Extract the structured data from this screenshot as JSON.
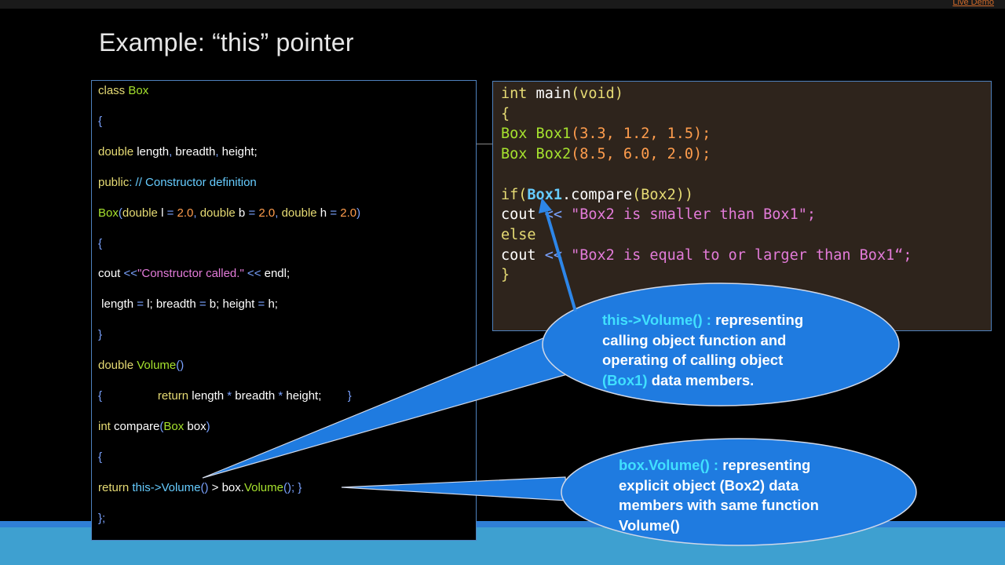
{
  "header": {
    "live_demo": "Live Demo",
    "title": "Example: “this” pointer"
  },
  "left_code": [
    [
      {
        "t": "class",
        "c": "k"
      },
      {
        "t": " Box",
        "c": "t"
      }
    ],
    [
      {
        "t": "{",
        "c": "o"
      }
    ],
    [
      {
        "t": "double",
        "c": "k"
      },
      {
        "t": " length",
        "c": "b"
      },
      {
        "t": ",",
        "c": "o"
      },
      {
        "t": " breadth",
        "c": "b"
      },
      {
        "t": ",",
        "c": "o"
      },
      {
        "t": " height;",
        "c": "b"
      }
    ],
    [
      {
        "t": "public",
        "c": "k"
      },
      {
        "t": ": // Constructor definition",
        "c": "c"
      }
    ],
    [
      {
        "t": "Box",
        "c": "t"
      },
      {
        "t": "(",
        "c": "o"
      },
      {
        "t": "double",
        "c": "k"
      },
      {
        "t": " l ",
        "c": "b"
      },
      {
        "t": "=",
        "c": "o"
      },
      {
        "t": " 2.0",
        "c": "n"
      },
      {
        "t": ",",
        "c": "o"
      },
      {
        "t": " double",
        "c": "k"
      },
      {
        "t": " b ",
        "c": "b"
      },
      {
        "t": "=",
        "c": "o"
      },
      {
        "t": " 2.0",
        "c": "n"
      },
      {
        "t": ",",
        "c": "o"
      },
      {
        "t": " double",
        "c": "k"
      },
      {
        "t": " h ",
        "c": "b"
      },
      {
        "t": "=",
        "c": "o"
      },
      {
        "t": " 2.0",
        "c": "n"
      },
      {
        "t": ")",
        "c": "o"
      }
    ],
    [
      {
        "t": "{",
        "c": "o"
      }
    ],
    [
      {
        "t": "cout ",
        "c": "b"
      },
      {
        "t": "<<",
        "c": "o"
      },
      {
        "t": "\"Constructor called.\"",
        "c": "s"
      },
      {
        "t": " << ",
        "c": "o"
      },
      {
        "t": "endl;",
        "c": "b"
      }
    ],
    [
      {
        "t": " length ",
        "c": "b"
      },
      {
        "t": "=",
        "c": "o"
      },
      {
        "t": " l; breadth ",
        "c": "b"
      },
      {
        "t": "=",
        "c": "o"
      },
      {
        "t": " b; height ",
        "c": "b"
      },
      {
        "t": "=",
        "c": "o"
      },
      {
        "t": " h;",
        "c": "b"
      }
    ],
    [
      {
        "t": "}",
        "c": "o"
      }
    ],
    [
      {
        "t": "double",
        "c": "k"
      },
      {
        "t": " Volume",
        "c": "t"
      },
      {
        "t": "()",
        "c": "o"
      }
    ],
    [
      {
        "t": "{",
        "c": "o"
      },
      {
        "t": "                 ",
        "c": "b"
      },
      {
        "t": "return",
        "c": "k"
      },
      {
        "t": " length ",
        "c": "b"
      },
      {
        "t": "*",
        "c": "o"
      },
      {
        "t": " breadth ",
        "c": "b"
      },
      {
        "t": "*",
        "c": "o"
      },
      {
        "t": " height;",
        "c": "b"
      },
      {
        "t": "        }",
        "c": "o"
      }
    ],
    [
      {
        "t": "int",
        "c": "k"
      },
      {
        "t": " compare",
        "c": "b"
      },
      {
        "t": "(",
        "c": "o"
      },
      {
        "t": "Box",
        "c": "t"
      },
      {
        "t": " box",
        "c": "b"
      },
      {
        "t": ")",
        "c": "o"
      }
    ],
    [
      {
        "t": "{",
        "c": "o"
      }
    ],
    [
      {
        "t": "return",
        "c": "k"
      },
      {
        "t": " this->Volume",
        "c": "c"
      },
      {
        "t": "()",
        "c": "o"
      },
      {
        "t": " > ",
        "c": "b"
      },
      {
        "t": "box.",
        "c": "b"
      },
      {
        "t": "Volume",
        "c": "t"
      },
      {
        "t": "();",
        "c": "o"
      },
      {
        "t": " }",
        "c": "o"
      }
    ],
    [
      {
        "t": "};",
        "c": "o"
      }
    ]
  ],
  "right_code": [
    [
      {
        "t": "int",
        "c": "k"
      },
      {
        "t": " main",
        "c": "b"
      },
      {
        "t": "(void)",
        "c": "k"
      }
    ],
    [
      {
        "t": "{",
        "c": "k"
      }
    ],
    [
      {
        "t": "Box Box1",
        "c": "t"
      },
      {
        "t": "(3.3, 1.2, 1.5);",
        "c": "n"
      }
    ],
    [
      {
        "t": "Box Box2",
        "c": "t"
      },
      {
        "t": "(8.5, 6.0, 2.0);",
        "c": "n"
      }
    ],
    [
      {
        "t": "",
        "c": "b"
      }
    ],
    [
      {
        "t": "if(",
        "c": "k"
      },
      {
        "t": "Box1",
        "c": "c",
        "bold": true
      },
      {
        "t": ".compare",
        "c": "b"
      },
      {
        "t": "(Box2))",
        "c": "k"
      }
    ],
    [
      {
        "t": "cout ",
        "c": "b"
      },
      {
        "t": "<<",
        "c": "o"
      },
      {
        "t": " \"Box2 is smaller than Box1\";",
        "c": "s"
      }
    ],
    [
      {
        "t": "else",
        "c": "k"
      }
    ],
    [
      {
        "t": "cout ",
        "c": "b"
      },
      {
        "t": "<<",
        "c": "o"
      },
      {
        "t": " \"Box2 is equal to or larger than Box1“;",
        "c": "s"
      }
    ],
    [
      {
        "t": "}",
        "c": "k"
      }
    ]
  ],
  "callouts": {
    "top": {
      "lines": [
        [
          {
            "t": "this->Volume() : ",
            "hl": true
          },
          {
            "t": "representing"
          }
        ],
        [
          {
            "t": "calling  object function and"
          }
        ],
        [
          {
            "t": "operating of calling  object"
          }
        ],
        [
          {
            "t": "(Box1)",
            "hl": true
          },
          {
            "t": " data members."
          }
        ]
      ]
    },
    "bottom": {
      "lines": [
        [
          {
            "t": "box.Volume() : ",
            "hl": true
          },
          {
            "t": "representing"
          }
        ],
        [
          {
            "t": "explicit  object (Box2) data"
          }
        ],
        [
          {
            "t": "members with  same function"
          }
        ],
        [
          {
            "t": "Volume()"
          }
        ]
      ]
    }
  },
  "colors": {
    "callout_fill": "#1f7be0",
    "callout_stroke": "#d0d8e8",
    "arrow": "#2d86e8",
    "highlight": "#40e0ff"
  }
}
